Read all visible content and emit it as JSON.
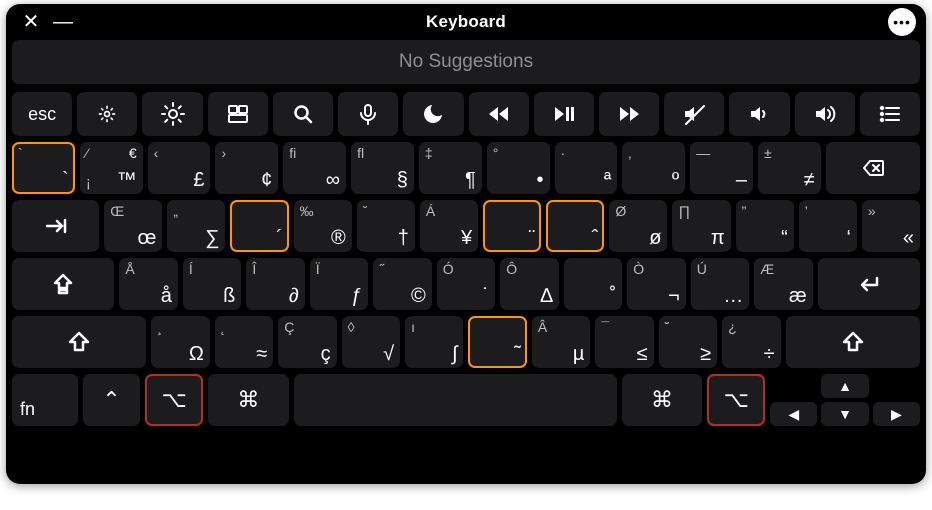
{
  "window": {
    "title": "Keyboard"
  },
  "suggestion_bar": {
    "text": "No Suggestions"
  },
  "fn_row": [
    {
      "name": "esc",
      "label": "esc"
    },
    {
      "name": "brightness-down",
      "icon": "brightness-low"
    },
    {
      "name": "brightness-up",
      "icon": "brightness-high"
    },
    {
      "name": "mission-control",
      "icon": "mission-control"
    },
    {
      "name": "spotlight",
      "icon": "search"
    },
    {
      "name": "dictation",
      "icon": "mic"
    },
    {
      "name": "do-not-disturb",
      "icon": "moon"
    },
    {
      "name": "rewind",
      "icon": "rewind"
    },
    {
      "name": "play-pause",
      "icon": "playpause"
    },
    {
      "name": "fast-forward",
      "icon": "fastforward"
    },
    {
      "name": "mute",
      "icon": "mute"
    },
    {
      "name": "volume-down",
      "icon": "volume-low"
    },
    {
      "name": "volume-up",
      "icon": "volume-high"
    },
    {
      "name": "list",
      "icon": "list"
    }
  ],
  "row1": [
    {
      "name": "grave",
      "tl": "`",
      "bl": "",
      "tr": "",
      "br": "`",
      "hl": "orange"
    },
    {
      "name": "one",
      "tl": "⁄",
      "bl": "¡",
      "tr": "€",
      "br": "™"
    },
    {
      "name": "two",
      "tl": "‹",
      "bl": "",
      "tr": "",
      "br": "£"
    },
    {
      "name": "three",
      "tl": "›",
      "bl": "",
      "tr": "",
      "br": "¢"
    },
    {
      "name": "four",
      "tl": "fi",
      "bl": "",
      "tr": "",
      "br": "∞"
    },
    {
      "name": "five",
      "tl": "fl",
      "bl": "",
      "tr": "",
      "br": "§"
    },
    {
      "name": "six",
      "tl": "‡",
      "bl": "",
      "tr": "",
      "br": "¶"
    },
    {
      "name": "seven",
      "tl": "°",
      "bl": "",
      "tr": "",
      "br": "•"
    },
    {
      "name": "eight",
      "tl": "·",
      "bl": "",
      "tr": "",
      "br": "ª"
    },
    {
      "name": "nine",
      "tl": "‚",
      "bl": "",
      "tr": "",
      "br": "º"
    },
    {
      "name": "zero",
      "tl": "—",
      "bl": "",
      "tr": "",
      "br": "–"
    },
    {
      "name": "minus",
      "tl": "±",
      "bl": "",
      "tr": "",
      "br": "≠"
    }
  ],
  "row1_backspace": {
    "label": "⌦"
  },
  "row2_tab": {
    "label": "tab"
  },
  "row2": [
    {
      "name": "q",
      "tl": "Œ",
      "bl": "",
      "tr": "",
      "br": "œ"
    },
    {
      "name": "w",
      "tl": "„",
      "bl": "",
      "tr": "",
      "br": "∑"
    },
    {
      "name": "e",
      "tl": "",
      "bl": "",
      "tr": "",
      "br": "´",
      "hl": "orange"
    },
    {
      "name": "r",
      "tl": "‰",
      "bl": "",
      "tr": "",
      "br": "®"
    },
    {
      "name": "t",
      "tl": "ˇ",
      "bl": "",
      "tr": "",
      "br": "†"
    },
    {
      "name": "y",
      "tl": "Á",
      "bl": "",
      "tr": "",
      "br": "¥"
    },
    {
      "name": "u",
      "tl": "",
      "bl": "",
      "tr": "",
      "br": "¨",
      "hl": "orange"
    },
    {
      "name": "i",
      "tl": "",
      "bl": "",
      "tr": "",
      "br": "ˆ",
      "hl": "orange"
    },
    {
      "name": "o",
      "tl": "Ø",
      "bl": "",
      "tr": "",
      "br": "ø"
    },
    {
      "name": "p",
      "tl": "∏",
      "bl": "",
      "tr": "",
      "br": "π"
    },
    {
      "name": "bracket-open",
      "tl": "”",
      "bl": "",
      "tr": "",
      "br": "“"
    },
    {
      "name": "bracket-close",
      "tl": "’",
      "bl": "",
      "tr": "",
      "br": "‘"
    },
    {
      "name": "backslash",
      "tl": "»",
      "bl": "",
      "tr": "",
      "br": "«"
    }
  ],
  "row3_caps": {
    "label": "caps"
  },
  "row3": [
    {
      "name": "a",
      "tl": "Å",
      "bl": "",
      "tr": "",
      "br": "å"
    },
    {
      "name": "s",
      "tl": "Í",
      "bl": "",
      "tr": "",
      "br": "ß"
    },
    {
      "name": "d",
      "tl": "Î",
      "bl": "",
      "tr": "",
      "br": "∂"
    },
    {
      "name": "f",
      "tl": "Ï",
      "bl": "",
      "tr": "",
      "br": "ƒ"
    },
    {
      "name": "g",
      "tl": "˝",
      "bl": "",
      "tr": "",
      "br": "©"
    },
    {
      "name": "h",
      "tl": "Ó",
      "bl": "",
      "tr": "",
      "br": "˙"
    },
    {
      "name": "j",
      "tl": "Ô",
      "bl": "",
      "tr": "",
      "br": "∆"
    },
    {
      "name": "k",
      "tl": "",
      "bl": "",
      "tr": "",
      "br": "˚"
    },
    {
      "name": "l",
      "tl": "Ò",
      "bl": "",
      "tr": "",
      "br": "¬"
    },
    {
      "name": "semicolon",
      "tl": "Ú",
      "bl": "",
      "tr": "",
      "br": "…"
    },
    {
      "name": "quote",
      "tl": "Æ",
      "bl": "",
      "tr": "",
      "br": "æ"
    }
  ],
  "row3_return": {
    "label": "return"
  },
  "row4_shift_l": {
    "label": "shift"
  },
  "row4": [
    {
      "name": "z",
      "tl": "¸",
      "bl": "",
      "tr": "",
      "br": "Ω"
    },
    {
      "name": "x",
      "tl": "˛",
      "bl": "",
      "tr": "",
      "br": "≈"
    },
    {
      "name": "c",
      "tl": "Ç",
      "bl": "",
      "tr": "",
      "br": "ç"
    },
    {
      "name": "v",
      "tl": "◊",
      "bl": "",
      "tr": "",
      "br": "√"
    },
    {
      "name": "b",
      "tl": "ı",
      "bl": "",
      "tr": "",
      "br": "∫"
    },
    {
      "name": "n",
      "tl": "",
      "bl": "",
      "tr": "",
      "br": "˜",
      "hl": "orange"
    },
    {
      "name": "m",
      "tl": "Â",
      "bl": "",
      "tr": "",
      "br": "µ"
    },
    {
      "name": "comma",
      "tl": "¯",
      "bl": "",
      "tr": "",
      "br": "≤"
    },
    {
      "name": "period",
      "tl": "˘",
      "bl": "",
      "tr": "",
      "br": "≥"
    },
    {
      "name": "slash",
      "tl": "¿",
      "bl": "",
      "tr": "",
      "br": "÷"
    }
  ],
  "row4_shift_r": {
    "label": "shift"
  },
  "row5": {
    "fn": "fn",
    "control": "⌃",
    "option_l": "⌥",
    "command_l": "⌘",
    "command_r": "⌘",
    "option_r": "⌥"
  },
  "arrows": {
    "up": "▲",
    "left": "◀",
    "down": "▼",
    "right": "▶"
  }
}
